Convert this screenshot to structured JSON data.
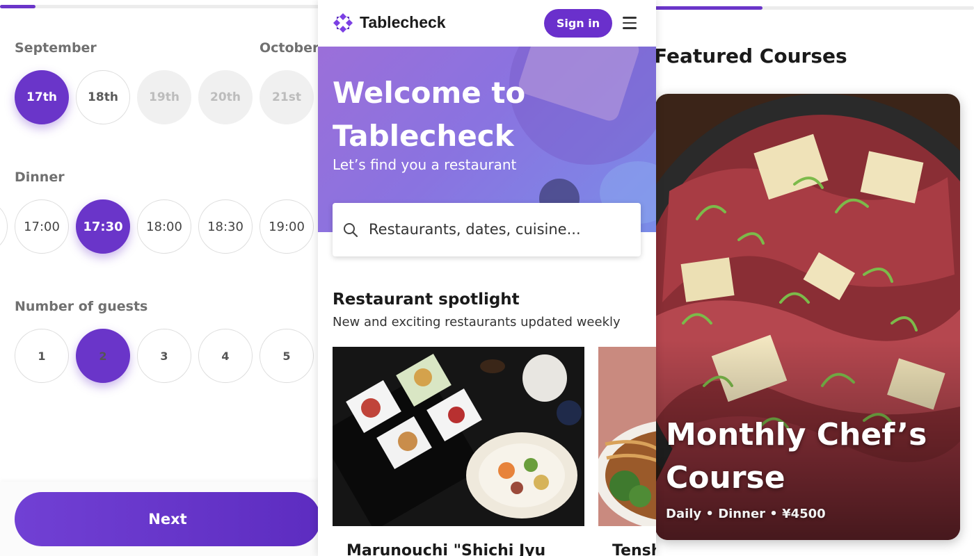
{
  "booking": {
    "progress_fraction": 0.11,
    "months": [
      "September",
      "October"
    ],
    "dates": [
      {
        "label": "17th",
        "state": "selected"
      },
      {
        "label": "18th",
        "state": "available"
      },
      {
        "label": "19th",
        "state": "disabled"
      },
      {
        "label": "20th",
        "state": "disabled"
      },
      {
        "label": "21st",
        "state": "disabled"
      }
    ],
    "meal_label": "Dinner",
    "times": [
      {
        "label": "17:00",
        "state": "available"
      },
      {
        "label": "17:30",
        "state": "selected"
      },
      {
        "label": "18:00",
        "state": "available"
      },
      {
        "label": "18:30",
        "state": "available"
      },
      {
        "label": "19:00",
        "state": "available"
      }
    ],
    "guests_label": "Number of guests",
    "guests": [
      {
        "label": "1",
        "state": "available"
      },
      {
        "label": "2",
        "state": "selected"
      },
      {
        "label": "3",
        "state": "available"
      },
      {
        "label": "4",
        "state": "available"
      },
      {
        "label": "5",
        "state": "available"
      }
    ],
    "next_label": "Next"
  },
  "app": {
    "name": "Tablecheck",
    "signin_label": "Sign in",
    "logo_icon": "tablecheck-logo-icon",
    "menu_icon": "hamburger-menu-icon",
    "hero": {
      "title": "Welcome to Tablecheck",
      "subtitle": "Let’s find you a restaurant"
    },
    "search": {
      "placeholder": "Restaurants, dates, cuisine...",
      "icon": "search-icon"
    },
    "spotlight": {
      "title": "Restaurant spotlight",
      "subtitle": "New and exciting restaurants updated weekly",
      "cards": [
        {
          "name": "Marunouchi \"Shichi Jyu"
        },
        {
          "name": "Tensh"
        }
      ]
    }
  },
  "featured": {
    "progress_fraction": 0.34,
    "title": "Featured Courses",
    "course": {
      "name": "Monthly Chef’s Course",
      "meta": "Daily • Dinner • ¥4500"
    }
  },
  "colors": {
    "accent": "#6a35c9",
    "hero_gradient_start": "#9b6fd9",
    "hero_gradient_end": "#7a8ce8"
  }
}
